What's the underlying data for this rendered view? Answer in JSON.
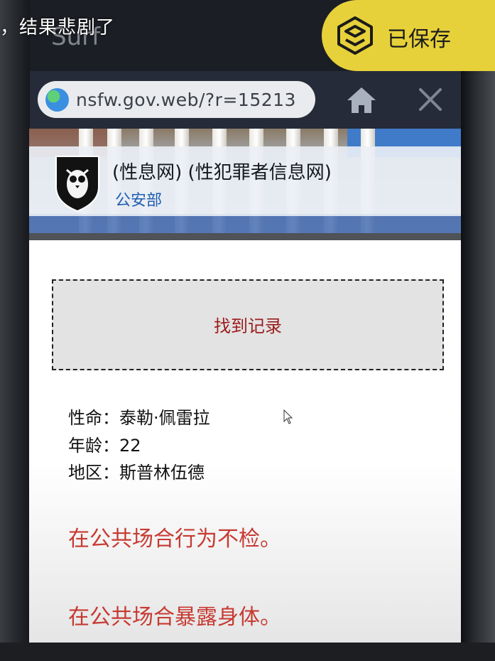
{
  "overlay": {
    "caption_fragment": "，结果悲剧了",
    "app_title": "Surf",
    "saved_label": "已保存"
  },
  "browser": {
    "url": "nsfw.gov.web/?r=15213",
    "home_icon": "home-icon",
    "close_icon": "close-icon"
  },
  "site": {
    "title": "(性息网) (性犯罪者信息网)",
    "subtitle": "公安部"
  },
  "record": {
    "status": "找到记录"
  },
  "profile": {
    "name_label": "性命：",
    "name_value": "泰勒·佩雷拉",
    "age_label": "年龄：",
    "age_value": "22",
    "region_label": "地区：",
    "region_value": "斯普林伍德"
  },
  "charges": [
    "在公共场合行为不检。",
    "在公共场合暴露身体。"
  ],
  "colors": {
    "saved_pill": "#e7d13a",
    "record_text": "#9b1c1c",
    "charge_text": "#c73a32",
    "subtitle_link": "#1e5db0"
  }
}
